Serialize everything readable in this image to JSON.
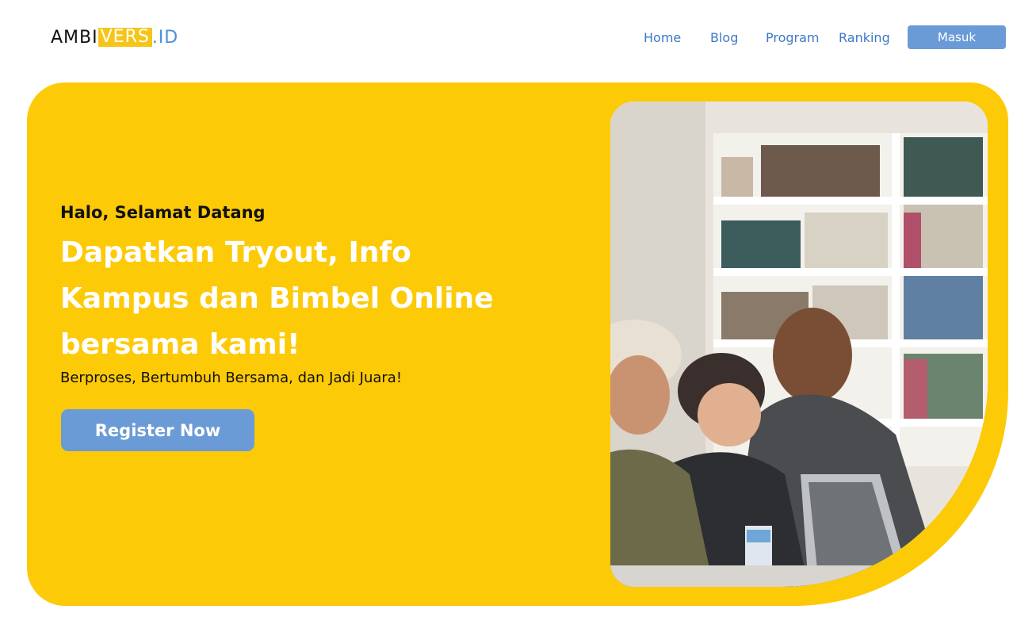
{
  "header": {
    "logo": {
      "part1": "AMBI",
      "part2": "VERS",
      "part3": ".ID"
    },
    "nav": {
      "home": "Home",
      "blog": "Blog",
      "program": "Program",
      "ranking": "Ranking"
    },
    "login_label": "Masuk"
  },
  "hero": {
    "greeting": "Halo, Selamat Datang",
    "headline": "Dapatkan Tryout, Info Kampus dan Bimbel Online bersama kami!",
    "tagline": "Berproses, Bertumbuh Bersama, dan Jadi Juara!",
    "register_label": "Register Now"
  },
  "colors": {
    "hero_bg": "#fdca08",
    "button_blue": "#6b9bd6",
    "nav_link": "#3d78c4",
    "logo_yellow": "#f5c518"
  },
  "image": {
    "subject": "students-laughing-at-laptop-in-library-photo"
  }
}
